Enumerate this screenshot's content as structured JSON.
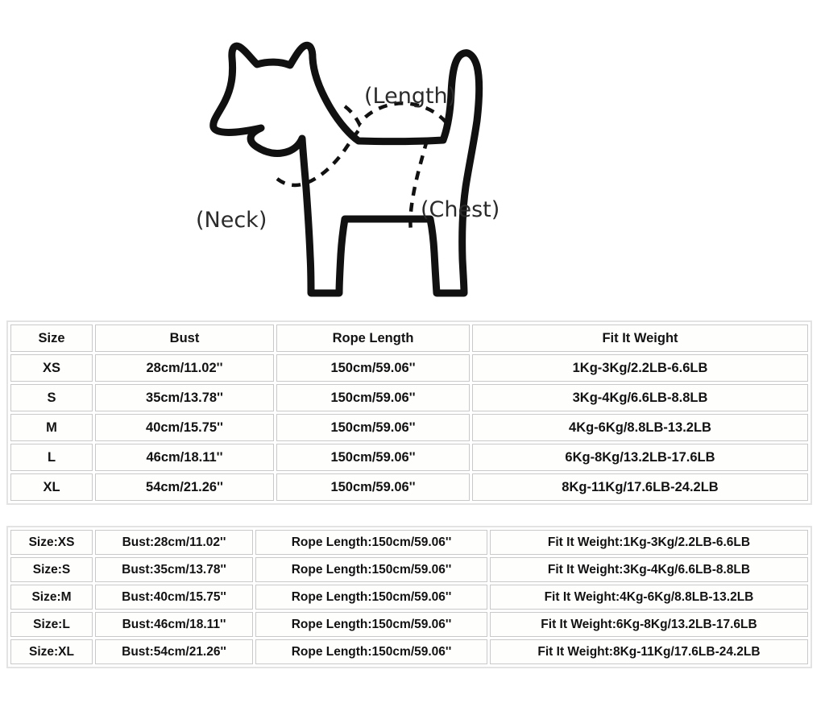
{
  "illustration": {
    "subject": "dog-outline",
    "labels": {
      "length": "(Length)",
      "neck": "(Neck)",
      "chest": "(Chest)"
    }
  },
  "primary_table": {
    "headers": [
      "Size",
      "Bust",
      "Rope Length",
      "Fit It Weight"
    ],
    "rows": [
      {
        "size": "XS",
        "bust": "28cm/11.02''",
        "rope_length": "150cm/59.06''",
        "fit_it_weight": "1Kg-3Kg/2.2LB-6.6LB"
      },
      {
        "size": "S",
        "bust": "35cm/13.78''",
        "rope_length": "150cm/59.06''",
        "fit_it_weight": "3Kg-4Kg/6.6LB-8.8LB"
      },
      {
        "size": "M",
        "bust": "40cm/15.75''",
        "rope_length": "150cm/59.06''",
        "fit_it_weight": "4Kg-6Kg/8.8LB-13.2LB"
      },
      {
        "size": "L",
        "bust": "46cm/18.11''",
        "rope_length": "150cm/59.06''",
        "fit_it_weight": "6Kg-8Kg/13.2LB-17.6LB"
      },
      {
        "size": "XL",
        "bust": "54cm/21.26''",
        "rope_length": "150cm/59.06''",
        "fit_it_weight": "8Kg-11Kg/17.6LB-24.2LB"
      }
    ]
  },
  "secondary_table": {
    "rows": [
      {
        "size": "Size:XS",
        "bust": "Bust:28cm/11.02''",
        "rope_length": "Rope Length:150cm/59.06''",
        "fit_it_weight": "Fit It Weight:1Kg-3Kg/2.2LB-6.6LB"
      },
      {
        "size": "Size:S",
        "bust": "Bust:35cm/13.78''",
        "rope_length": "Rope Length:150cm/59.06''",
        "fit_it_weight": "Fit It Weight:3Kg-4Kg/6.6LB-8.8LB"
      },
      {
        "size": "Size:M",
        "bust": "Bust:40cm/15.75''",
        "rope_length": "Rope Length:150cm/59.06''",
        "fit_it_weight": "Fit It Weight:4Kg-6Kg/8.8LB-13.2LB"
      },
      {
        "size": "Size:L",
        "bust": "Bust:46cm/18.11''",
        "rope_length": "Rope Length:150cm/59.06''",
        "fit_it_weight": "Fit It Weight:6Kg-8Kg/13.2LB-17.6LB"
      },
      {
        "size": "Size:XL",
        "bust": "Bust:54cm/21.26''",
        "rope_length": "Rope Length:150cm/59.06''",
        "fit_it_weight": "Fit It Weight:8Kg-11Kg/17.6LB-24.2LB"
      }
    ]
  },
  "colors": {
    "background": "#ffffff",
    "outline": "#111111",
    "table_border": "#c9c9c9",
    "frame_border": "#e3e3e3",
    "text": "#121212"
  }
}
